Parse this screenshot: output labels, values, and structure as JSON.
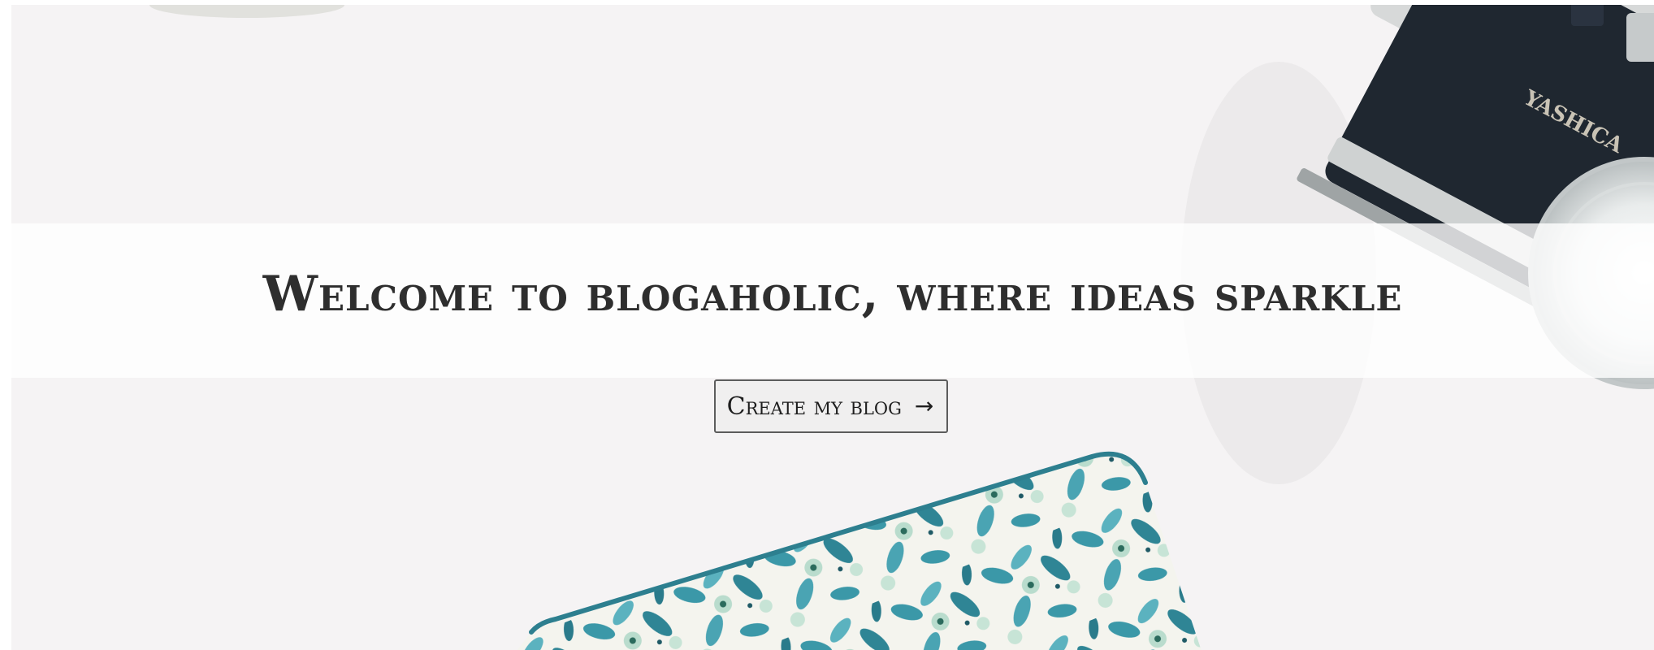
{
  "hero": {
    "headline": "Welcome to blogaholic, where ideas sparkle",
    "cta_label": "Create my blog",
    "cta_icon": "arrow-right-icon",
    "cta_arrow_glyph": "→",
    "camera_brand": "YASHICA"
  },
  "colors": {
    "headline_text": "#2e2e2e",
    "banner_overlay": "#ffffff",
    "button_border": "#5c5c5c",
    "background": "#f5f3f4",
    "camera_body": "#1f2730",
    "pattern_teal": "#3b98a8",
    "pattern_mint": "#b9dccd"
  }
}
